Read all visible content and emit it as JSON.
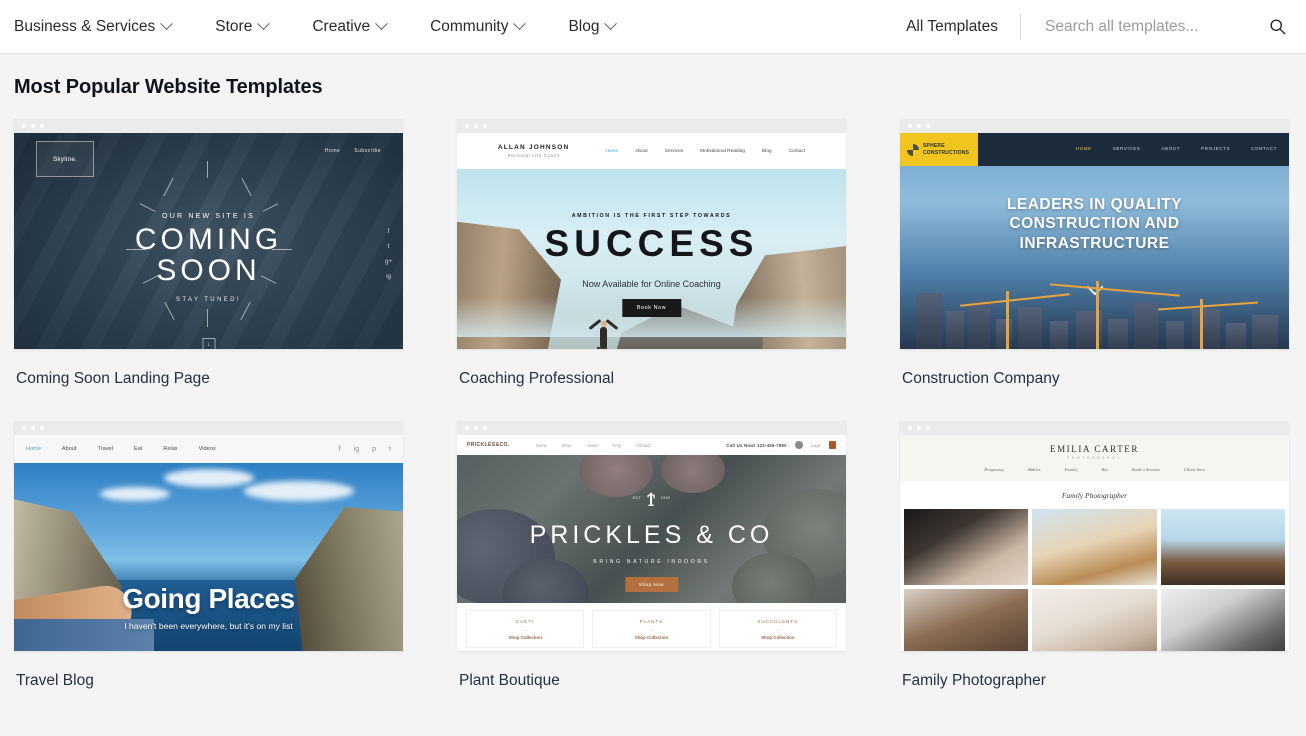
{
  "header": {
    "nav": [
      {
        "label": "Business & Services",
        "has_chevron": true
      },
      {
        "label": "Store",
        "has_chevron": true
      },
      {
        "label": "Creative",
        "has_chevron": true
      },
      {
        "label": "Community",
        "has_chevron": true
      },
      {
        "label": "Blog",
        "has_chevron": true
      }
    ],
    "all_templates": "All Templates",
    "search_placeholder": "Search all templates...",
    "search_value": "",
    "search_icon": "search-icon"
  },
  "page": {
    "title": "Most Popular Website Templates",
    "background": "#f4f4f4",
    "accent": "#4ea3e0"
  },
  "templates": [
    {
      "label": "Coming Soon Landing Page",
      "preview": {
        "logo": "Skyline.",
        "nav": [
          "Home",
          "Subscribe"
        ],
        "eyebrow": "OUR NEW SITE IS",
        "headline_line1": "COMING",
        "headline_line2": "SOON",
        "subtext": "STAY TUNED!",
        "social": [
          "f",
          "t",
          "g+",
          "ig"
        ],
        "scroll_icon": "down-arrow-icon",
        "bg_color": "#33495b"
      }
    },
    {
      "label": "Coaching Professional",
      "preview": {
        "brand_name": "ALLAN JOHNSON",
        "brand_sub": "Personal Life Coach",
        "nav": [
          "Home",
          "About",
          "Services",
          "Motivational Reading",
          "Blog",
          "Contact"
        ],
        "eyebrow": "AMBITION IS THE FIRST STEP TOWARDS",
        "headline": "SUCCESS",
        "subtext": "Now Available for Online Coaching",
        "button": "Book Now",
        "bg_color": "#cfe6ec"
      }
    },
    {
      "label": "Construction Company",
      "preview": {
        "logo_line1": "SPHERE",
        "logo_line2": "CONSTRUCTIONS",
        "logo_color": "#f2c41e",
        "nav": [
          "HOME",
          "SERVICES",
          "ABOUT",
          "PROJECTS",
          "CONTACT"
        ],
        "headline_line1": "LEADERS IN QUALITY",
        "headline_line2": "CONSTRUCTION AND",
        "headline_line3": "INFRASTRUCTURE",
        "scroll_icon": "chevron-down-icon",
        "bg_color": "#4e7ea8"
      }
    },
    {
      "label": "Travel Blog",
      "preview": {
        "nav": [
          "Home",
          "About",
          "Travel",
          "Eat",
          "Relax",
          "Videos"
        ],
        "active_nav": "Home",
        "social": [
          "f",
          "ig",
          "p",
          "t"
        ],
        "headline": "Going Places",
        "subtext": "I haven't been everywhere, but it's on my list",
        "bg_color": "#63a9dd"
      }
    },
    {
      "label": "Plant Boutique",
      "preview": {
        "brand": "PRICKLES&CO.",
        "nav": [
          "Home",
          "Shop",
          "About",
          "FAQ",
          "Contact"
        ],
        "phone": "Call Us Now! 123-456-7890",
        "login": "Login",
        "headline": "PRICKLES & CO",
        "tagline": "BRING NATURE INDOORS",
        "button": "Shop Now",
        "categories": [
          {
            "name": "CACTI",
            "link": "Shop Collection"
          },
          {
            "name": "PLANTS",
            "link": "Shop Collection"
          },
          {
            "name": "SUCCULENTS",
            "link": "Shop Collection"
          }
        ],
        "bg_color": "#6d7570"
      }
    },
    {
      "label": "Family Photographer",
      "preview": {
        "brand": "EMILIA CARTER",
        "brand_sub": "PHOTOGRAPHY",
        "nav": [
          "Pregnancy",
          "Babies",
          "Family",
          "Bio",
          "Book a Session",
          "Client Area"
        ],
        "tagline": "Family Photographer",
        "bg_color": "#f7f5f2"
      }
    }
  ]
}
